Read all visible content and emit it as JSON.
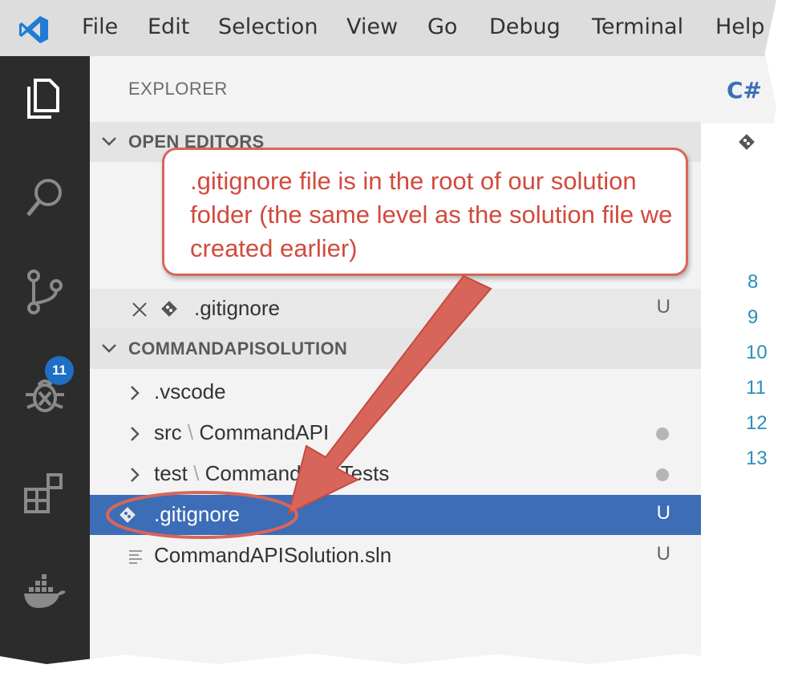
{
  "menu": [
    "File",
    "Edit",
    "Selection",
    "View",
    "Go",
    "Debug",
    "Terminal",
    "Help"
  ],
  "activity_bar": {
    "icons": [
      "explorer-icon",
      "search-icon",
      "source-control-icon",
      "debug-icon",
      "extensions-icon",
      "docker-icon"
    ],
    "scm_badge": "11"
  },
  "explorer": {
    "title": "EXPLORER",
    "open_editors": {
      "label": "OPEN EDITORS",
      "items": [
        {
          "name": ".gitignore",
          "status": "U"
        }
      ]
    },
    "workspace": {
      "label": "COMMANDAPISOLUTION",
      "items": [
        {
          "name": ".vscode"
        },
        {
          "folder": "src",
          "sep": " \\ ",
          "sub": "CommandAPI"
        },
        {
          "folder": "test",
          "sep": " \\ ",
          "sub": "CommandAPI.Tests"
        },
        {
          "name": ".gitignore",
          "status": "U"
        },
        {
          "name": "CommandAPISolution.sln",
          "status": "U"
        }
      ]
    }
  },
  "editor": {
    "tab_icon": "C#",
    "line_numbers": [
      "8",
      "9",
      "10",
      "11",
      "12",
      "13"
    ]
  },
  "callout": {
    "text": ".gitignore file is in the root of our solution folder (the same level as the solution file we created earlier)"
  },
  "colors": {
    "selection": "#3c6db6",
    "callout_accent": "#d8655a",
    "callout_text": "#d24a3d",
    "activity_bar": "#2c2c2c",
    "badge": "#1f6fc5"
  }
}
